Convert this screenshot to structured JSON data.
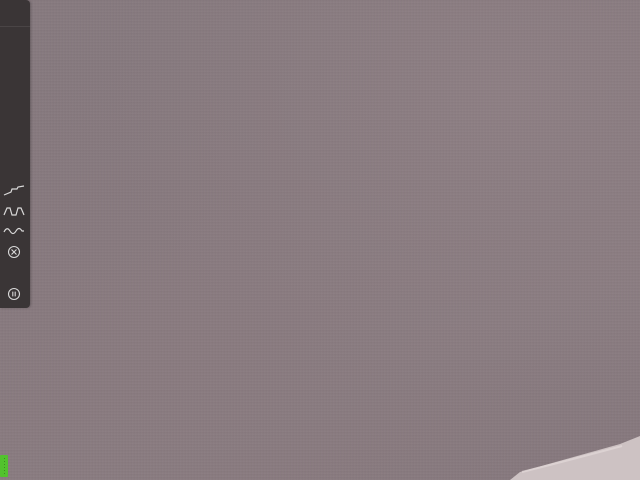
{
  "scene": {
    "background_color": "#877a7f",
    "couch_color": "#cfc5c6"
  },
  "tool_panel": {
    "background_color": "#3a3536",
    "icon_color": "#d9d9d9",
    "tools": [
      {
        "id": "ramp",
        "icon": "ramp-wave-icon"
      },
      {
        "id": "square",
        "icon": "square-wave-icon"
      },
      {
        "id": "sine",
        "icon": "sine-wave-icon"
      },
      {
        "id": "random",
        "icon": "random-cross-circle-icon"
      },
      {
        "id": "pause",
        "icon": "pause-circle-icon"
      }
    ]
  },
  "status_badge": {
    "color": "#52c22e",
    "label": "......"
  }
}
